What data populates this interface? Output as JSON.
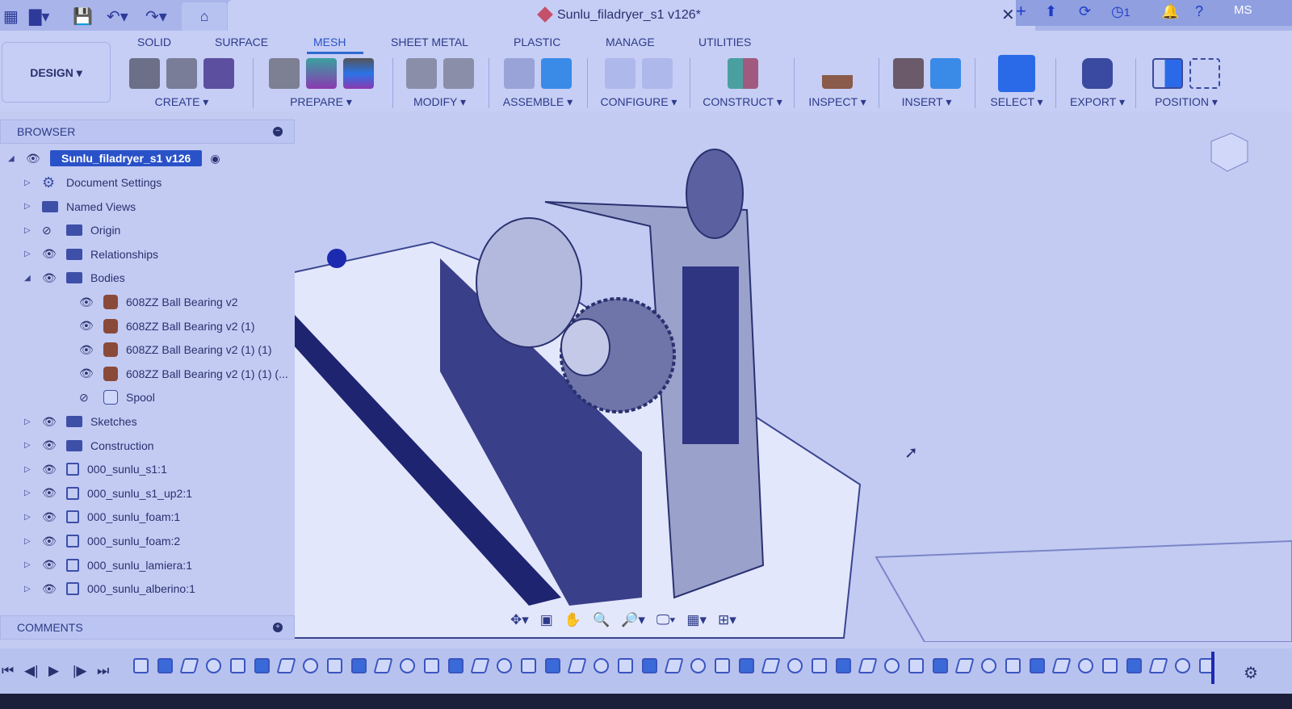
{
  "app": {
    "document_title": "Sunlu_filadryer_s1 v126*",
    "user_initials": "MS",
    "job_count": "1"
  },
  "toolbar": {
    "workspace": "DESIGN ▾",
    "tabs": [
      "SOLID",
      "SURFACE",
      "MESH",
      "SHEET METAL",
      "PLASTIC",
      "MANAGE",
      "UTILITIES"
    ],
    "active_tab": "MESH",
    "groups": [
      "CREATE ▾",
      "PREPARE ▾",
      "MODIFY ▾",
      "ASSEMBLE ▾",
      "CONFIGURE ▾",
      "CONSTRUCT ▾",
      "INSPECT ▾",
      "INSERT ▾",
      "SELECT ▾",
      "EXPORT ▾",
      "POSITION ▾"
    ]
  },
  "browser": {
    "title": "BROWSER",
    "root": "Sunlu_filadryer_s1 v126",
    "items": [
      {
        "label": "Document Settings",
        "icon": "gear-icon"
      },
      {
        "label": "Named Views",
        "icon": "folder-icon"
      },
      {
        "label": "Origin",
        "icon": "folder-icon"
      },
      {
        "label": "Relationships",
        "icon": "folder-icon"
      },
      {
        "label": "Bodies",
        "icon": "folder-icon"
      },
      {
        "label": "608ZZ Ball Bearing v2",
        "icon": "body-icon"
      },
      {
        "label": "608ZZ Ball Bearing v2 (1)",
        "icon": "body-icon"
      },
      {
        "label": "608ZZ Ball Bearing v2 (1) (1)",
        "icon": "body-icon"
      },
      {
        "label": "608ZZ Ball Bearing v2 (1) (1) (...",
        "icon": "body-icon"
      },
      {
        "label": "Spool",
        "icon": "body-icon"
      },
      {
        "label": "Sketches",
        "icon": "folder-icon"
      },
      {
        "label": "Construction",
        "icon": "folder-icon"
      },
      {
        "label": "000_sunlu_s1:1",
        "icon": "component-icon"
      },
      {
        "label": "000_sunlu_s1_up2:1",
        "icon": "component-icon"
      },
      {
        "label": "000_sunlu_foam:1",
        "icon": "component-icon"
      },
      {
        "label": "000_sunlu_foam:2",
        "icon": "component-icon"
      },
      {
        "label": "000_sunlu_lamiera:1",
        "icon": "component-icon"
      },
      {
        "label": "000_sunlu_alberino:1",
        "icon": "component-icon"
      }
    ]
  },
  "comments": {
    "title": "COMMENTS"
  },
  "colors": {
    "accent": "#2a52c8",
    "background": "#c3cbf3"
  }
}
